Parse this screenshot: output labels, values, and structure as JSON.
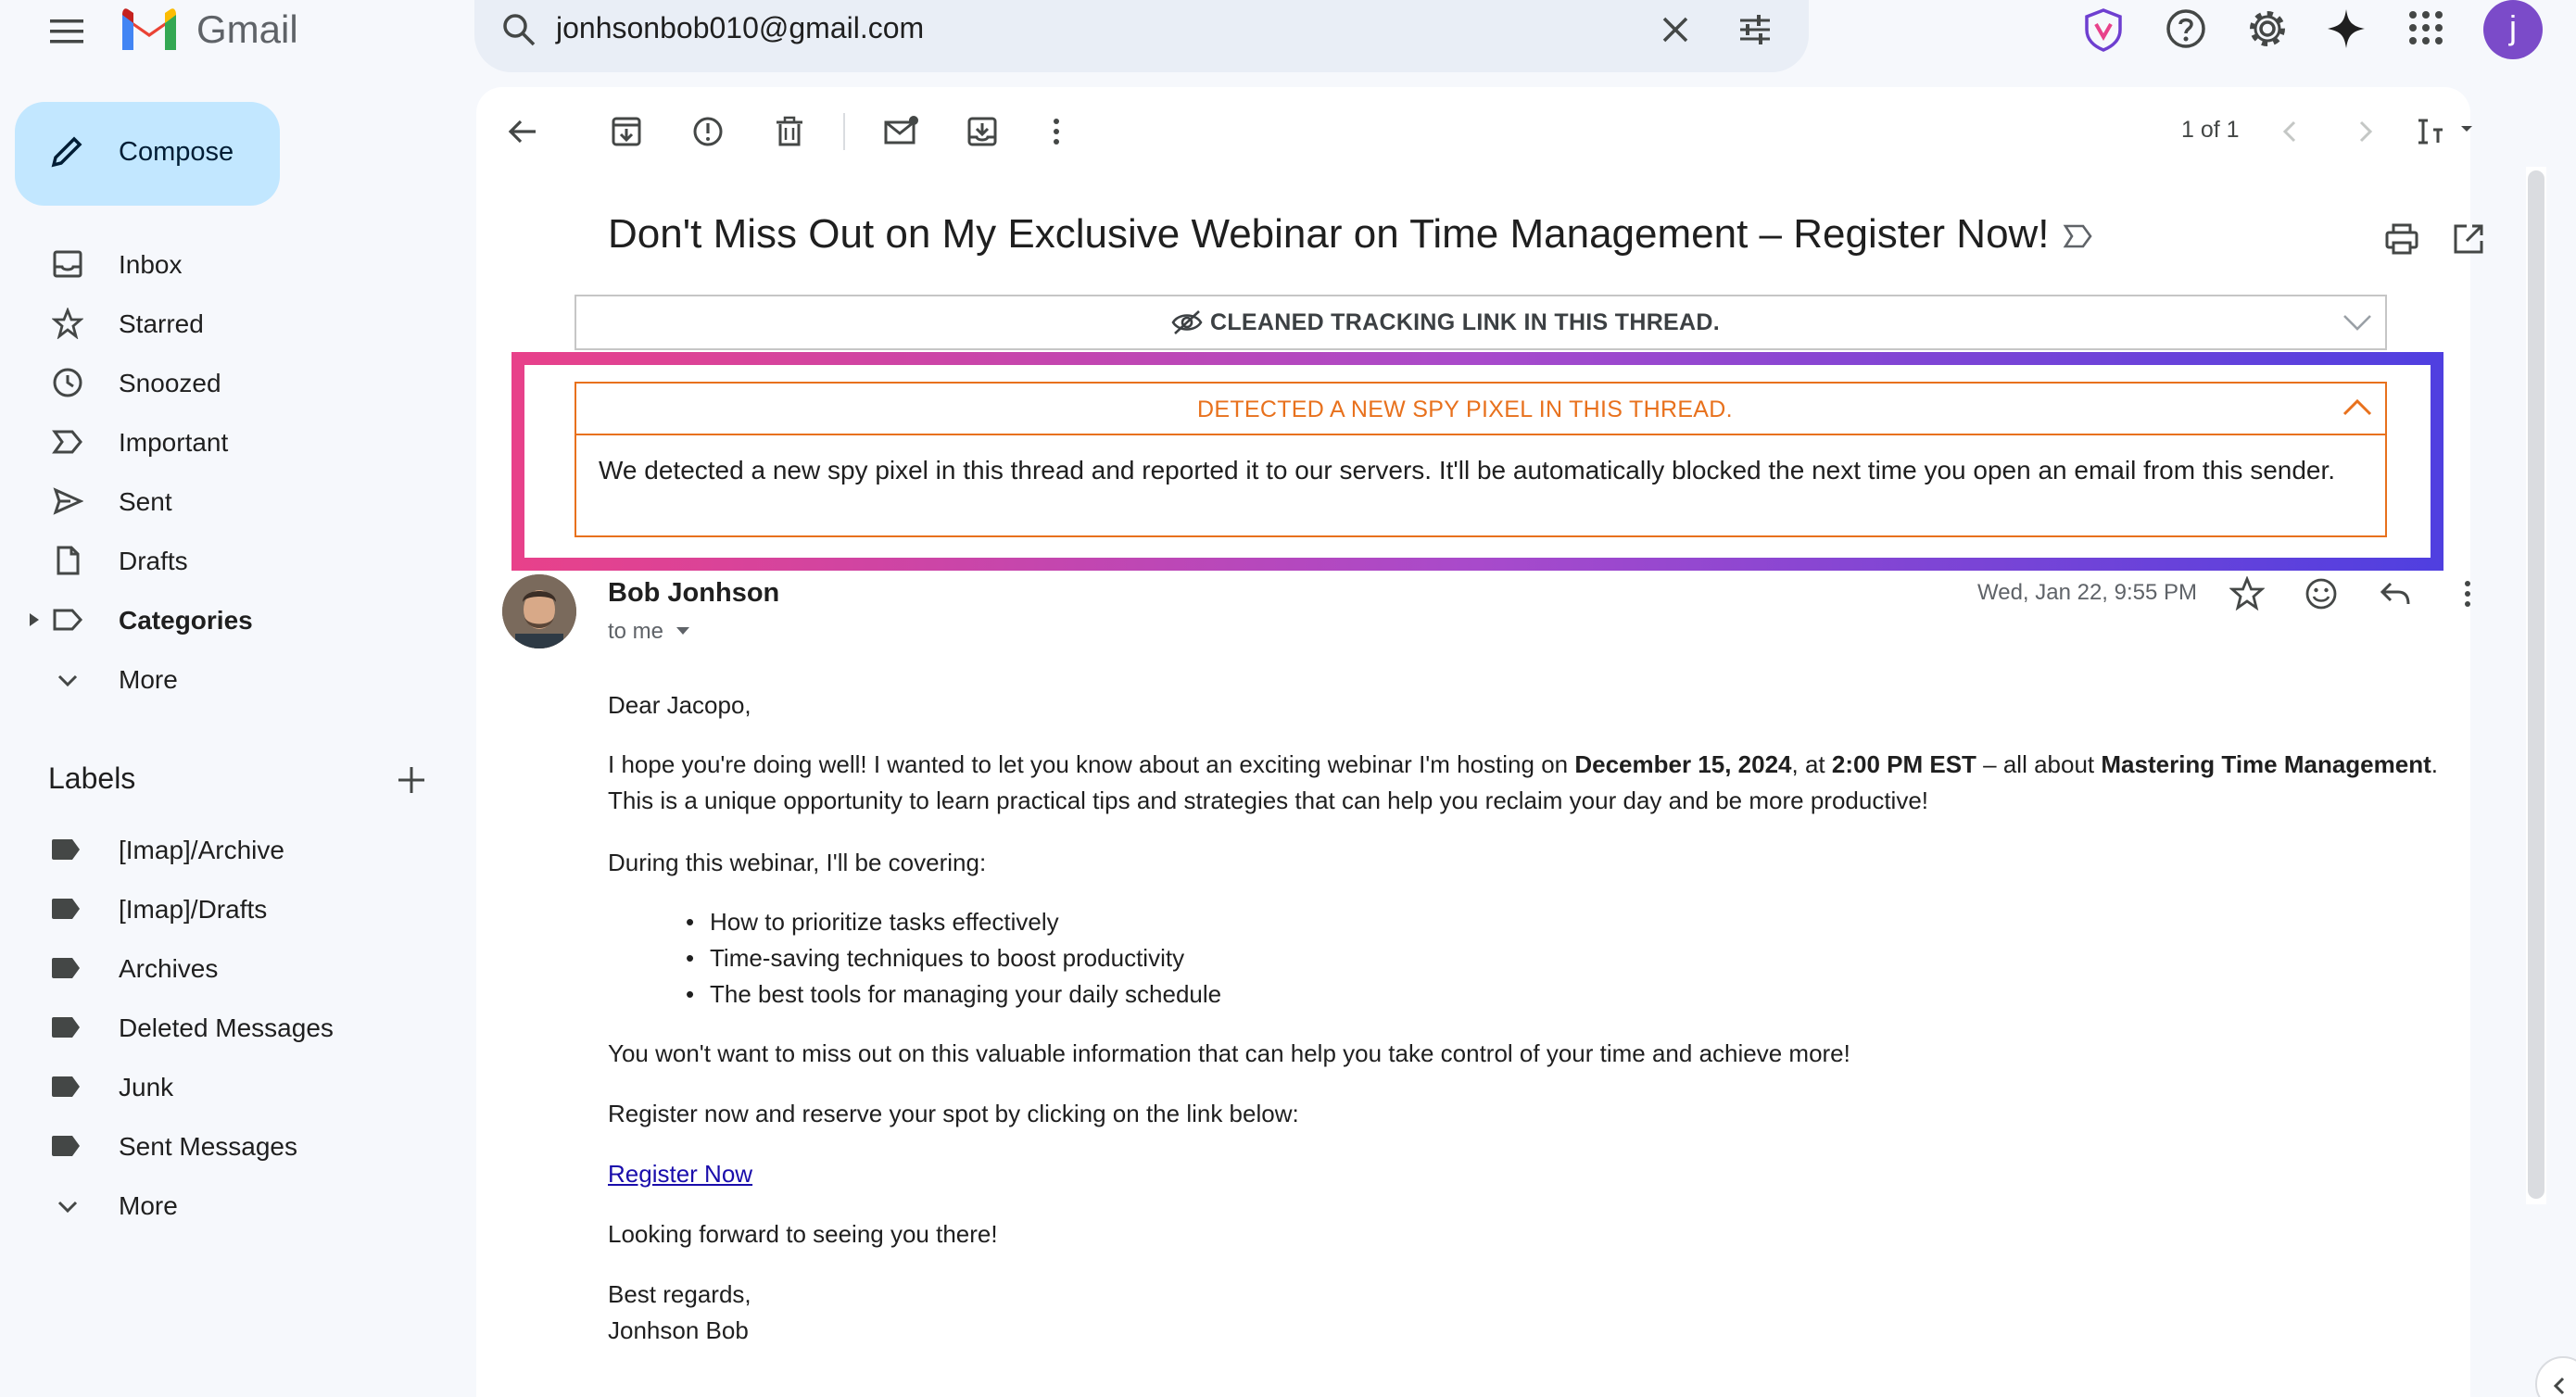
{
  "app": {
    "brand": "Gmail",
    "search_value": "jonhsonbob010@gmail.com",
    "account_initial": "j"
  },
  "sidebar": {
    "compose_label": "Compose",
    "nav": [
      {
        "label": "Inbox",
        "icon": "inbox-icon"
      },
      {
        "label": "Starred",
        "icon": "star-icon"
      },
      {
        "label": "Snoozed",
        "icon": "clock-icon"
      },
      {
        "label": "Important",
        "icon": "important-icon"
      },
      {
        "label": "Sent",
        "icon": "send-icon"
      },
      {
        "label": "Drafts",
        "icon": "draft-icon"
      },
      {
        "label": "Categories",
        "icon": "label-icon"
      },
      {
        "label": "More",
        "icon": "chevron-down-icon"
      }
    ],
    "labels_title": "Labels",
    "labels": [
      {
        "label": "[Imap]/Archive"
      },
      {
        "label": "[Imap]/Drafts"
      },
      {
        "label": "Archives"
      },
      {
        "label": "Deleted Messages"
      },
      {
        "label": "Junk"
      },
      {
        "label": "Sent Messages"
      }
    ],
    "labels_more": "More"
  },
  "toolbar": {
    "pager": "1 of 1"
  },
  "email": {
    "subject": "Don't Miss Out on My Exclusive Webinar on Time Management – Register Now!",
    "cleaned_banner": "CLEANED TRACKING LINK IN THIS THREAD.",
    "spy_title": "DETECTED A NEW SPY PIXEL IN THIS THREAD.",
    "spy_body": "We detected a new spy pixel in this thread and reported it to our servers. It'll be automatically blocked the next time you open an email from this sender.",
    "sender_name": "Bob Jonhson",
    "to": "to me",
    "date": "Wed, Jan 22, 9:55 PM",
    "greeting": "Dear Jacopo,",
    "p1_a": "I hope you're doing well! I wanted to let you know about an exciting webinar I'm hosting on ",
    "p1_date": "December 15, 2024",
    "p1_b": ", at ",
    "p1_time": "2:00 PM EST",
    "p1_c": " – all about ",
    "p1_topic": "Mastering Time Management",
    "p1_d": ".",
    "p1_line2": "This is a unique opportunity to learn practical tips and strategies that can help you reclaim your day and be more productive!",
    "p2": "During this webinar, I'll be covering:",
    "bullets": [
      "How to prioritize tasks effectively",
      "Time-saving techniques to boost productivity",
      "The best tools for managing your daily schedule"
    ],
    "p3": "You won't want to miss out on this valuable information that can help you take control of your time and achieve more!",
    "p4": "Register now and reserve your spot by clicking on the link below:",
    "link": "Register Now",
    "p5": "Looking forward to seeing you there!",
    "signoff": "Best regards,",
    "signature": "Jonhson Bob"
  },
  "colors": {
    "accent": "#c2e7ff",
    "warning": "#e8711d",
    "gradient_start": "#e8418a",
    "gradient_end": "#4f3fe0",
    "link": "#1a0dab"
  }
}
